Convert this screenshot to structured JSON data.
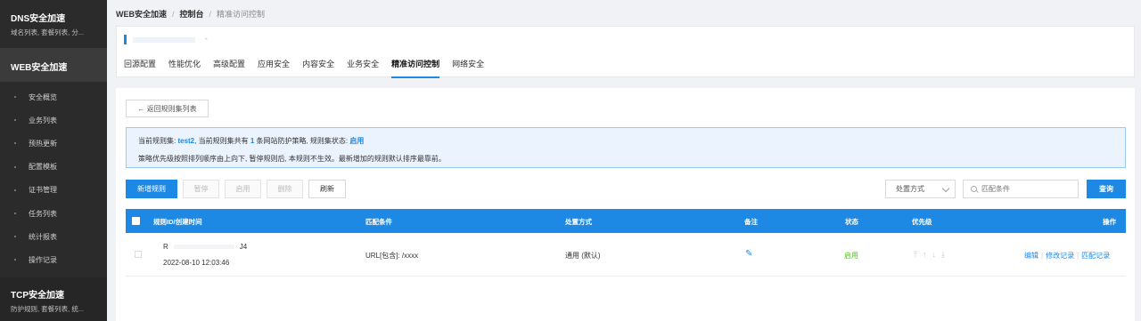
{
  "sidebar": {
    "dns": {
      "title": "DNS安全加速",
      "sub": "域名列表, 套餐列表, 分..."
    },
    "web": {
      "title": "WEB安全加速"
    },
    "items": [
      "安全概览",
      "业务列表",
      "预热更新",
      "配置模板",
      "证书管理",
      "任务列表",
      "统计报表",
      "操作记录"
    ],
    "tcp": {
      "title": "TCP安全加速",
      "sub": "防护规则, 套餐列表, 统..."
    }
  },
  "breadcrumb": {
    "root": "WEB安全加速",
    "mid": "控制台",
    "current": "精准访问控制"
  },
  "header": {
    "id_suffix": "-",
    "tabs": [
      "回源配置",
      "性能优化",
      "高级配置",
      "应用安全",
      "内容安全",
      "业务安全",
      "精准访问控制",
      "网络安全"
    ],
    "active_tab": 6
  },
  "main": {
    "back_label": "← 返回规则集列表",
    "alert": {
      "p1": "当前规则集: ",
      "ruleset": "test2",
      "p2": ", 当前规则集共有 ",
      "count": "1",
      "p3": " 条网站防护策略, 规则集状态: ",
      "status": "启用",
      "line2": "策略优先级按照排列顺序由上向下, 暂停规则后, 本规则不生效。最新增加的规则默认排序最靠前。"
    },
    "toolbar": {
      "new": "新增规则",
      "pause": "暂停",
      "enable": "启用",
      "delete": "删除",
      "refresh": "刷新",
      "select_value": "处置方式",
      "search_placeholder": "匹配条件",
      "query": "查询"
    },
    "table": {
      "headers": {
        "id": "规则ID/创建时间",
        "match": "匹配条件",
        "action": "处置方式",
        "note": "备注",
        "status": "状态",
        "priority": "优先级",
        "ops": "操作"
      },
      "rows": [
        {
          "id_prefix": "R",
          "id_suffix": "J4",
          "created": "2022-08-10 12:03:46",
          "match": "URL[包含]: /xxxx",
          "action": "通用 (默认)",
          "status": "启用",
          "priority_icons": "⤒↑↓⤓",
          "op_edit": "编辑",
          "op_log": "修改记录",
          "op_match_log": "匹配记录"
        }
      ]
    }
  }
}
